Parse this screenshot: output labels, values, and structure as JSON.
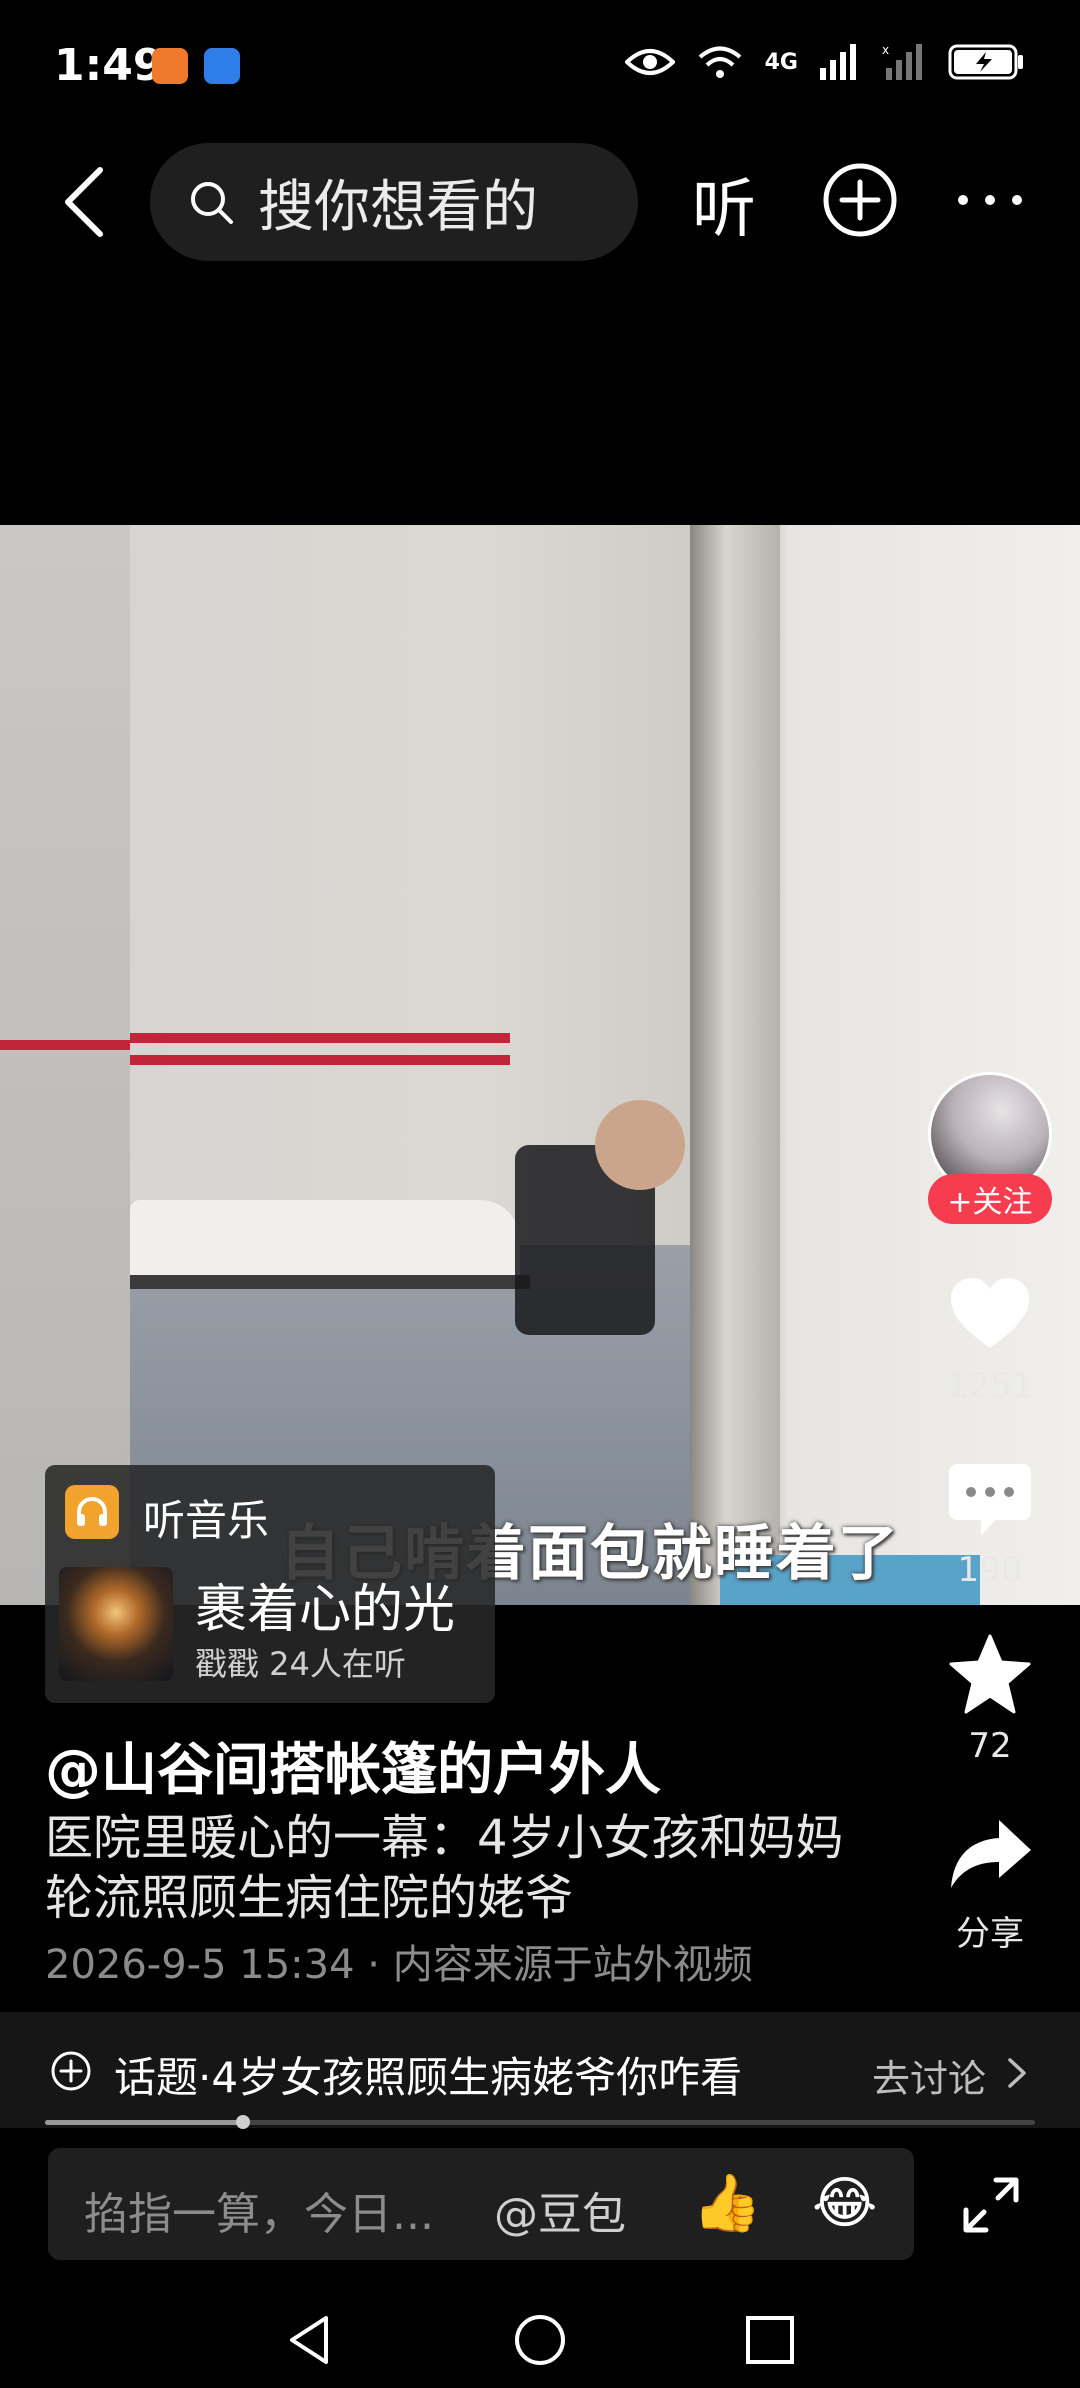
{
  "status_bar": {
    "time": "1:49",
    "network": "4G"
  },
  "top_nav": {
    "search_placeholder": "搜你想看的",
    "listen_label": "听"
  },
  "video": {
    "subtitle": "自己啃着面包就睡着了"
  },
  "music_card": {
    "label": "听音乐",
    "song_title": "裹着心的光",
    "listeners": "戳戳 24人在听"
  },
  "actions": {
    "follow_label": "+关注",
    "like_count": "1251",
    "comment_count": "190",
    "favorite_count": "72",
    "share_label": "分享"
  },
  "post": {
    "author": "@山谷间搭帐篷的户外人",
    "description": "医院里暖心的一幕：4岁小女孩和妈妈轮流照顾生病住院的姥爷",
    "meta": "2026-9-5 15:34 · 内容来源于站外视频"
  },
  "topic": {
    "text": "话题·4岁女孩照顾生病姥爷你咋看",
    "action": "去讨论"
  },
  "progress": {
    "played_fraction": 0.2
  },
  "comment_bar": {
    "placeholder": "掐指一算，今日...",
    "doubao": "@豆包",
    "emoji_1": "👍",
    "emoji_2": "😂"
  },
  "colors": {
    "follow_red": "#f53d4f",
    "music_orange": "#f1a32d"
  }
}
